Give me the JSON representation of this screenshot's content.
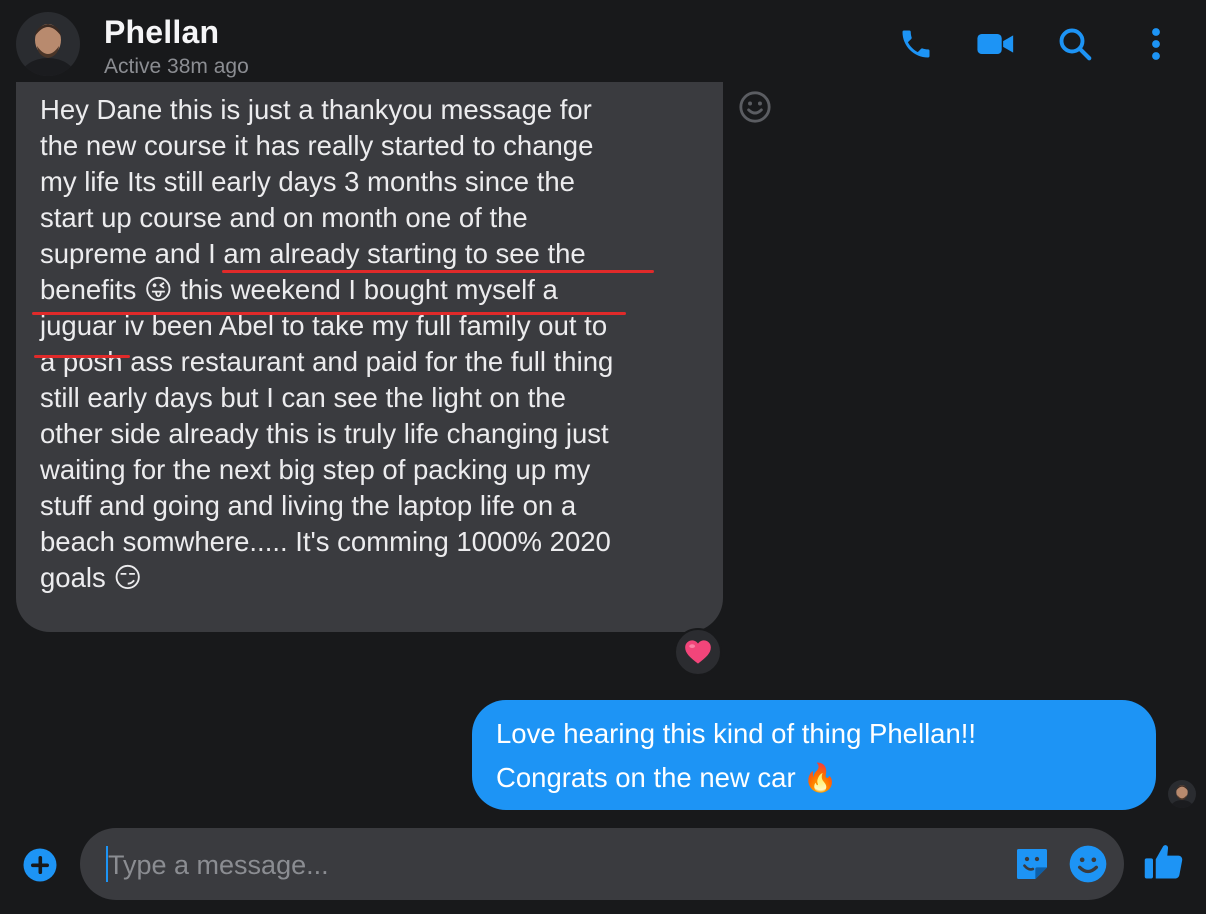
{
  "header": {
    "contact_name": "Phellan",
    "status": "Active 38m ago",
    "icons": [
      "phone-icon",
      "video-camera-icon",
      "search-icon",
      "more-vertical-icon"
    ]
  },
  "messages": [
    {
      "direction": "incoming",
      "lines": [
        "Hey Dane this is just a thankyou message for",
        "the new course it has really started to change",
        "my life Its still early days 3 months since the",
        "start up course and on month one of the",
        "supreme and I am already starting to see the",
        "benefits 😜 this weekend I bought myself a",
        "juguar iv been Abel to take my full family out to",
        "a posh ass restaurant and paid for the full thing",
        "still early days but I can see the light on the",
        "other side already this is truly life changing just",
        "waiting for the next big step of packing up my",
        "stuff and going and living the laptop life on a",
        "beach somwhere..... It's comming 1000% 2020",
        "goals 😏"
      ],
      "reaction": "❤",
      "underline_color": "#e02a2a"
    },
    {
      "direction": "outgoing",
      "lines": [
        "Love hearing this kind of thing Phellan!!",
        "Congrats on the new car 🔥"
      ]
    }
  ],
  "composer": {
    "placeholder": "Type a message...",
    "value": ""
  },
  "colors": {
    "background": "#18191b",
    "incoming_bubble": "#3a3b3f",
    "outgoing_bubble": "#1d94f5",
    "accent": "#1d94f5"
  }
}
